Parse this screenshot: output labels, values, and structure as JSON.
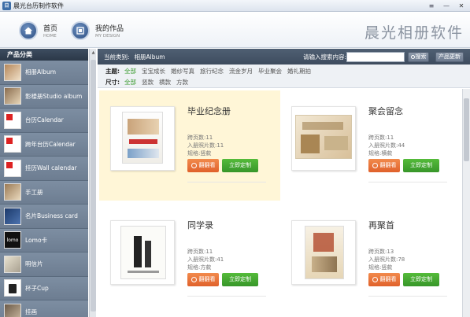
{
  "window": {
    "title": "晨光台历制作软件",
    "app_icon": "app-icon",
    "controls": [
      "≡",
      "—",
      "✕"
    ]
  },
  "header": {
    "nav": [
      {
        "label": "首页",
        "sub": "HOME",
        "icon": "home-icon"
      },
      {
        "label": "我的作品",
        "sub": "MY DESIGN",
        "icon": "my-design-icon"
      }
    ],
    "brand": "晨光相册软件"
  },
  "sidebar": {
    "title": "产品分类",
    "items": [
      {
        "label": "相册Album",
        "thumb": "album"
      },
      {
        "label": "影楼册Studio album",
        "thumb": "studio"
      },
      {
        "label": "台历Calendar",
        "thumb": "calendar"
      },
      {
        "label": "跨年台历Calendar",
        "thumb": "calendar2"
      },
      {
        "label": "挂历Wall calendar",
        "thumb": "wall"
      },
      {
        "label": "手工册",
        "thumb": "handmade"
      },
      {
        "label": "名片Business card",
        "thumb": "card"
      },
      {
        "label": "Lomo卡",
        "thumb": "lomo"
      },
      {
        "label": "明信片",
        "thumb": "postcard"
      },
      {
        "label": "杯子Cup",
        "thumb": "cup"
      },
      {
        "label": "挂画",
        "thumb": "painting"
      }
    ]
  },
  "topbar": {
    "current_label": "当前类别:",
    "current_value": "相册Album",
    "search_label": "请输入搜索内容:",
    "search_value": "",
    "search_button": "搜索",
    "update_button": "产品更新"
  },
  "filters": {
    "theme_label": "主题:",
    "themes": [
      "全部",
      "宝宝成长",
      "婚纱写真",
      "旅行纪念",
      "流金岁月",
      "毕业聚会",
      "婚礼期拍"
    ],
    "size_label": "尺寸:",
    "sizes": [
      "全部",
      "竖款",
      "横款",
      "方款"
    ]
  },
  "products": [
    {
      "title": "毕业纪念册",
      "pages": "跨页数:11",
      "photos": "入册照片数:11",
      "spec": "规格:竖款",
      "flip": "翻翻看",
      "make": "立即定制",
      "highlighted": true
    },
    {
      "title": "聚会留念",
      "pages": "跨页数:11",
      "photos": "入册照片数:44",
      "spec": "规格:横款",
      "flip": "翻翻看",
      "make": "立即定制",
      "highlighted": false
    },
    {
      "title": "同学录",
      "pages": "跨页数:11",
      "photos": "入册照片数:41",
      "spec": "规格:方款",
      "flip": "翻翻看",
      "make": "立即定制",
      "highlighted": false
    },
    {
      "title": "再聚首",
      "pages": "跨页数:13",
      "photos": "入册照片数:78",
      "spec": "规格:竖款",
      "flip": "翻翻看",
      "make": "立即定制",
      "highlighted": false
    }
  ],
  "colors": {
    "sidebar": "#6e7f93",
    "topbar": "#45546a",
    "active_filter": "#3a9a2e",
    "flip_button": "#e8713a",
    "make_button": "#45a830",
    "highlight": "#fff6d7"
  }
}
